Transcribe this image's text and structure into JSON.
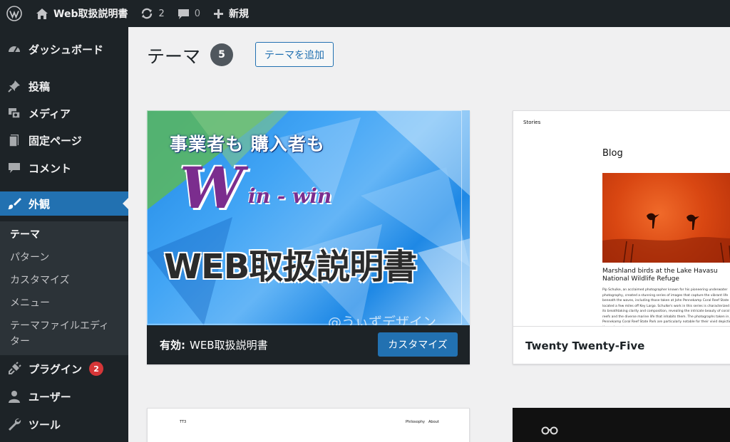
{
  "adminbar": {
    "site_name": "Web取扱説明書",
    "updates_count": "2",
    "comments_count": "0",
    "new_label": "新規"
  },
  "sidebar": {
    "items": [
      {
        "label": "ダッシュボード",
        "icon": "dashboard-icon"
      },
      {
        "label": "投稿",
        "icon": "pin-icon"
      },
      {
        "label": "メディア",
        "icon": "media-icon"
      },
      {
        "label": "固定ページ",
        "icon": "page-icon"
      },
      {
        "label": "コメント",
        "icon": "comment-icon"
      },
      {
        "label": "外観",
        "icon": "brush-icon"
      },
      {
        "label": "プラグイン",
        "icon": "plugin-icon",
        "badge": "2"
      },
      {
        "label": "ユーザー",
        "icon": "user-icon"
      },
      {
        "label": "ツール",
        "icon": "wrench-icon"
      }
    ],
    "submenu": [
      "テーマ",
      "パターン",
      "カスタマイズ",
      "メニュー",
      "テーマファイルエディ",
      "ター"
    ]
  },
  "main": {
    "title": "テーマ",
    "count": "5",
    "add_button": "テーマを追加"
  },
  "active_theme": {
    "screenshot": {
      "line1": "事業者も 購入者も",
      "logo_w": "W",
      "logo_rest": "in - win",
      "main_text": "WEB取扱説明書",
      "watermark": "@うぃずデザイン"
    },
    "label": "有効:",
    "name": "WEB取扱説明書",
    "customize_button": "カスタマイズ"
  },
  "theme_tt5": {
    "preview": {
      "stories": "Stories",
      "blog": "Blog",
      "caption": "Marshland birds at the Lake Havasu National Wildlife Refuge",
      "text": "Pip Schulke, an acclaimed photographer known for his pioneering underwater photography, created a stunning series of images that capture the vibrant life beneath the waves, including those taken at John Pennekamp Coral Reef State Park, located a few miles off Key Largo. Schulke's work in this series is characterized by its breathtaking clarity and composition, revealing the intricate beauty of coral reefs and the diverse marine life that inhabits them. The photographs taken in John Pennekamp Coral Reef State Park are particularly notable for their vivid depiction of the underwater ecosystem."
    },
    "name": "Twenty Twenty-Five"
  },
  "theme_tt3": {
    "preview": {
      "label": "TT3",
      "nav1": "Philosophy",
      "nav2": "About"
    }
  },
  "colors": {
    "admin_dark": "#1d2327",
    "accent": "#2271b1",
    "badge_red": "#d63638"
  }
}
